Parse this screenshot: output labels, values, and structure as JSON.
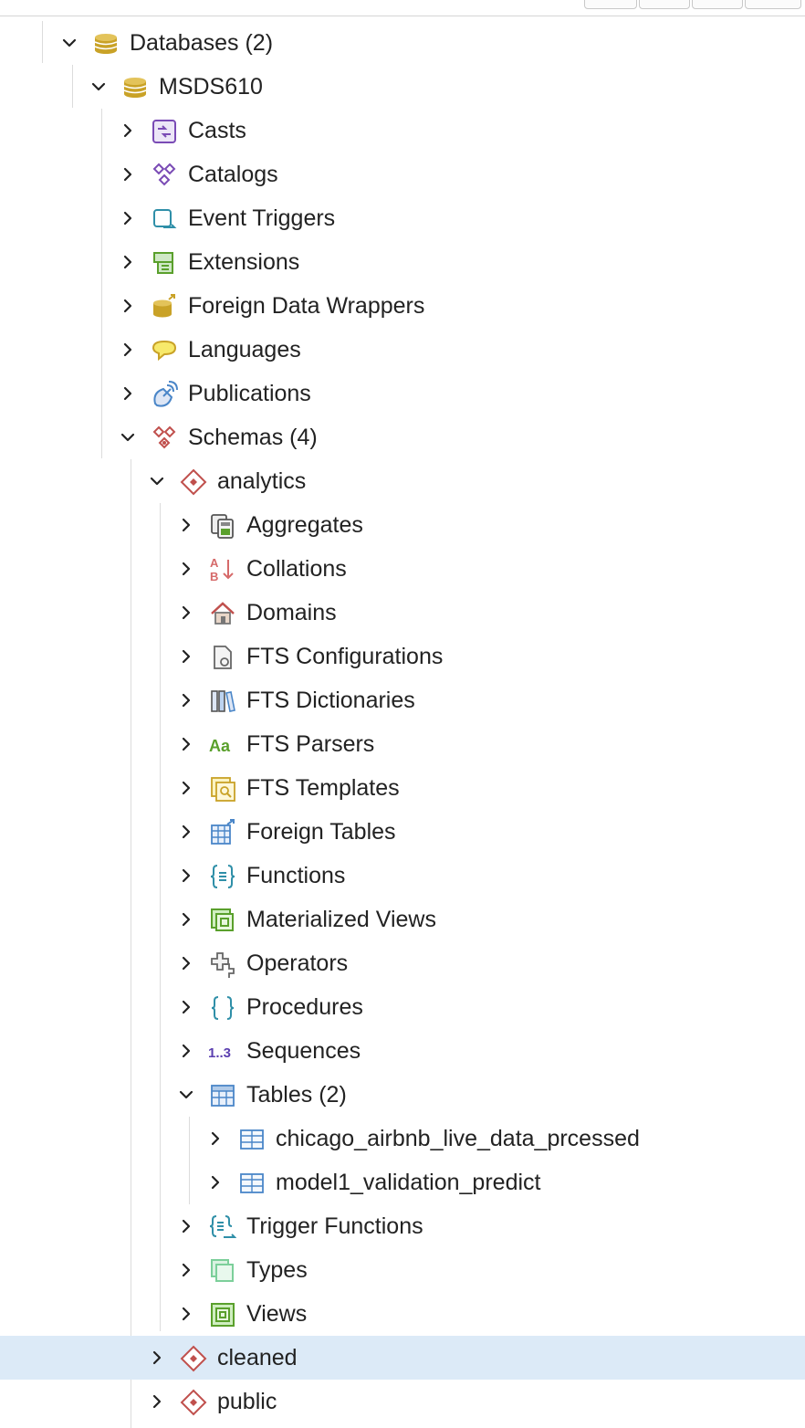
{
  "tree": {
    "databases": {
      "label": "Databases (2)",
      "icon": "database-icon"
    },
    "msds610": {
      "label": "MSDS610",
      "icon": "database-icon"
    },
    "db_items": [
      {
        "label": "Casts",
        "icon": "casts-icon"
      },
      {
        "label": "Catalogs",
        "icon": "catalogs-icon"
      },
      {
        "label": "Event Triggers",
        "icon": "event-triggers-icon"
      },
      {
        "label": "Extensions",
        "icon": "extensions-icon"
      },
      {
        "label": "Foreign Data Wrappers",
        "icon": "foreign-data-wrappers-icon"
      },
      {
        "label": "Languages",
        "icon": "languages-icon"
      },
      {
        "label": "Publications",
        "icon": "publications-icon"
      }
    ],
    "schemas": {
      "label": "Schemas (4)",
      "icon": "schemas-icon"
    },
    "analytics": {
      "label": "analytics",
      "icon": "schema-icon"
    },
    "analytics_items": [
      {
        "label": "Aggregates",
        "icon": "aggregates-icon"
      },
      {
        "label": "Collations",
        "icon": "collations-icon"
      },
      {
        "label": "Domains",
        "icon": "domains-icon"
      },
      {
        "label": "FTS Configurations",
        "icon": "fts-configurations-icon"
      },
      {
        "label": "FTS Dictionaries",
        "icon": "fts-dictionaries-icon"
      },
      {
        "label": "FTS Parsers",
        "icon": "fts-parsers-icon",
        "glyph": "Aa"
      },
      {
        "label": "FTS Templates",
        "icon": "fts-templates-icon"
      },
      {
        "label": "Foreign Tables",
        "icon": "foreign-tables-icon"
      },
      {
        "label": "Functions",
        "icon": "functions-icon"
      },
      {
        "label": "Materialized Views",
        "icon": "materialized-views-icon"
      },
      {
        "label": "Operators",
        "icon": "operators-icon"
      },
      {
        "label": "Procedures",
        "icon": "procedures-icon"
      },
      {
        "label": "Sequences",
        "icon": "sequences-icon",
        "glyph": "1..3"
      }
    ],
    "tables": {
      "label": "Tables (2)",
      "icon": "tables-icon"
    },
    "table_items": [
      {
        "label": "chicago_airbnb_live_data_prcessed",
        "icon": "table-icon"
      },
      {
        "label": "model1_validation_predict",
        "icon": "table-icon"
      }
    ],
    "after_tables_items": [
      {
        "label": "Trigger Functions",
        "icon": "trigger-functions-icon"
      },
      {
        "label": "Types",
        "icon": "types-icon"
      },
      {
        "label": "Views",
        "icon": "views-icon"
      }
    ],
    "other_schemas": [
      {
        "label": "cleaned",
        "icon": "schema-icon",
        "selected": true
      },
      {
        "label": "public",
        "icon": "schema-icon",
        "selected": false
      }
    ]
  },
  "colors": {
    "selection": "#dceaf7",
    "guide": "#dcdcdc",
    "database": "#c9a227",
    "schema": "#c0504d",
    "purple": "#7a4bb5",
    "teal": "#2f8fa8",
    "green": "#5aa02c",
    "blue": "#4a86c8"
  }
}
